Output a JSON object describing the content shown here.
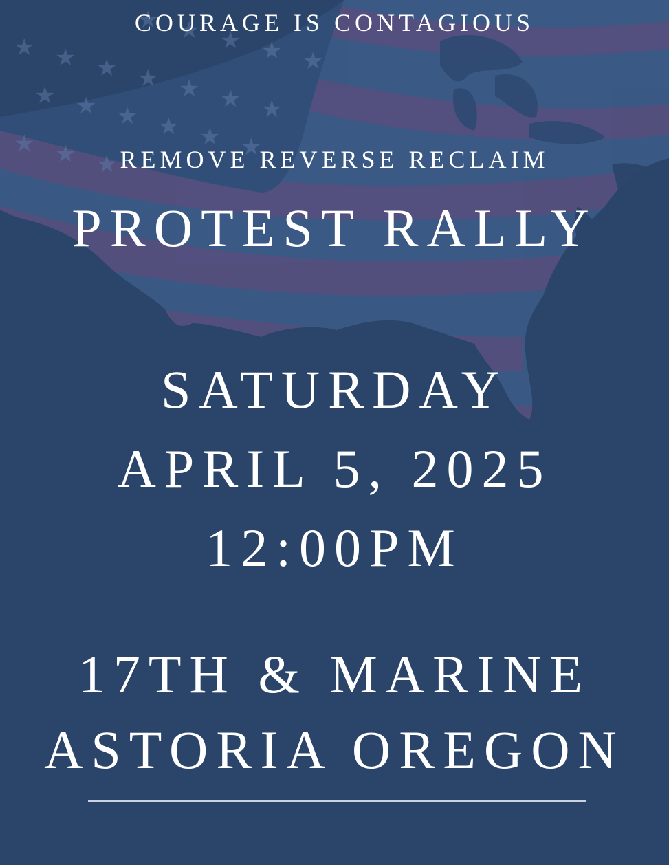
{
  "poster": {
    "tagline": "COURAGE IS CONTAGIOUS",
    "subtitle": "REMOVE REVERSE RECLAIM",
    "title": "PROTEST RALLY",
    "day": "SATURDAY",
    "date": "APRIL 5, 2025",
    "time": "12:00PM",
    "address_line1": "17TH & MARINE",
    "address_line2": "ASTORIA OREGON"
  },
  "background": {
    "image": "american-flag-usa-map-overlay",
    "base_color": "#2b4469",
    "flag_stripe_color": "#5a4f7a",
    "flag_canton_color": "#3a5a86"
  }
}
